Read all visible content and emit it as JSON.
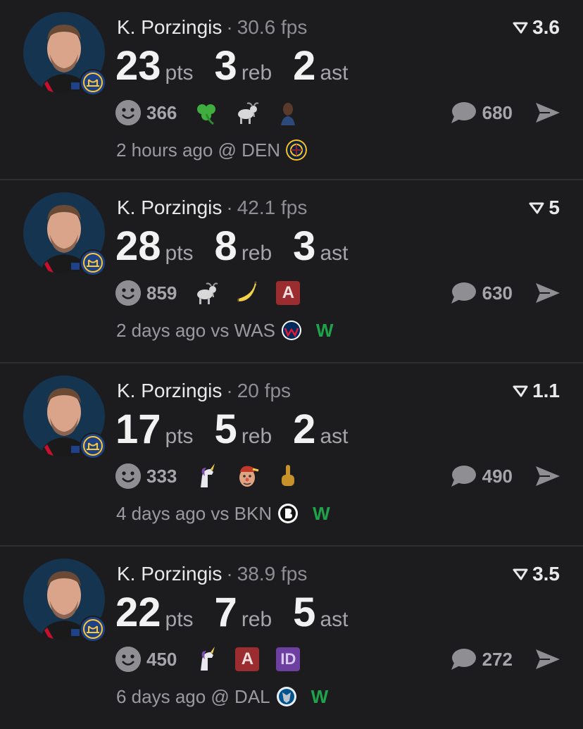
{
  "posts": [
    {
      "player": "K. Porzingis",
      "fps": "30.6 fps",
      "score": "3.6",
      "stats": [
        {
          "value": "23",
          "unit": "pts"
        },
        {
          "value": "3",
          "unit": "reb"
        },
        {
          "value": "2",
          "unit": "ast"
        }
      ],
      "reaction_count": "366",
      "emojis": [
        "shamrock",
        "goat",
        "player-face"
      ],
      "comment_count": "680",
      "time": "2 hours ago @ DEN",
      "opponent": "DEN",
      "result": ""
    },
    {
      "player": "K. Porzingis",
      "fps": "42.1 fps",
      "score": "5",
      "stats": [
        {
          "value": "28",
          "unit": "pts"
        },
        {
          "value": "8",
          "unit": "reb"
        },
        {
          "value": "3",
          "unit": "ast"
        }
      ],
      "reaction_count": "859",
      "emojis": [
        "goat",
        "banana",
        "letter-a"
      ],
      "letter_badge": "A",
      "comment_count": "630",
      "time": "2 days ago vs WAS",
      "opponent": "WAS",
      "result": "W"
    },
    {
      "player": "K. Porzingis",
      "fps": "20 fps",
      "score": "1.1",
      "stats": [
        {
          "value": "17",
          "unit": "pts"
        },
        {
          "value": "5",
          "unit": "reb"
        },
        {
          "value": "2",
          "unit": "ast"
        }
      ],
      "reaction_count": "333",
      "emojis": [
        "unicorn",
        "clown-face",
        "middle-finger"
      ],
      "comment_count": "490",
      "time": "4 days ago vs BKN",
      "opponent": "BKN",
      "result": "W"
    },
    {
      "player": "K. Porzingis",
      "fps": "38.9 fps",
      "score": "3.5",
      "stats": [
        {
          "value": "22",
          "unit": "pts"
        },
        {
          "value": "7",
          "unit": "reb"
        },
        {
          "value": "5",
          "unit": "ast"
        }
      ],
      "reaction_count": "450",
      "emojis": [
        "unicorn",
        "letter-a",
        "letters-id"
      ],
      "letter_badge": "A",
      "letters_badge": "ID",
      "comment_count": "272",
      "time": "6 days ago @ DAL",
      "opponent": "DAL",
      "result": "W"
    }
  ],
  "colors": {
    "background": "#1c1c1e",
    "win": "#1fa34a",
    "muted": "#8e8e93",
    "letter_a_bg": "#9b2d30",
    "letters_id_bg": "#6d3fa0",
    "warriors_blue": "#1d428a",
    "warriors_gold": "#ffc72c"
  }
}
